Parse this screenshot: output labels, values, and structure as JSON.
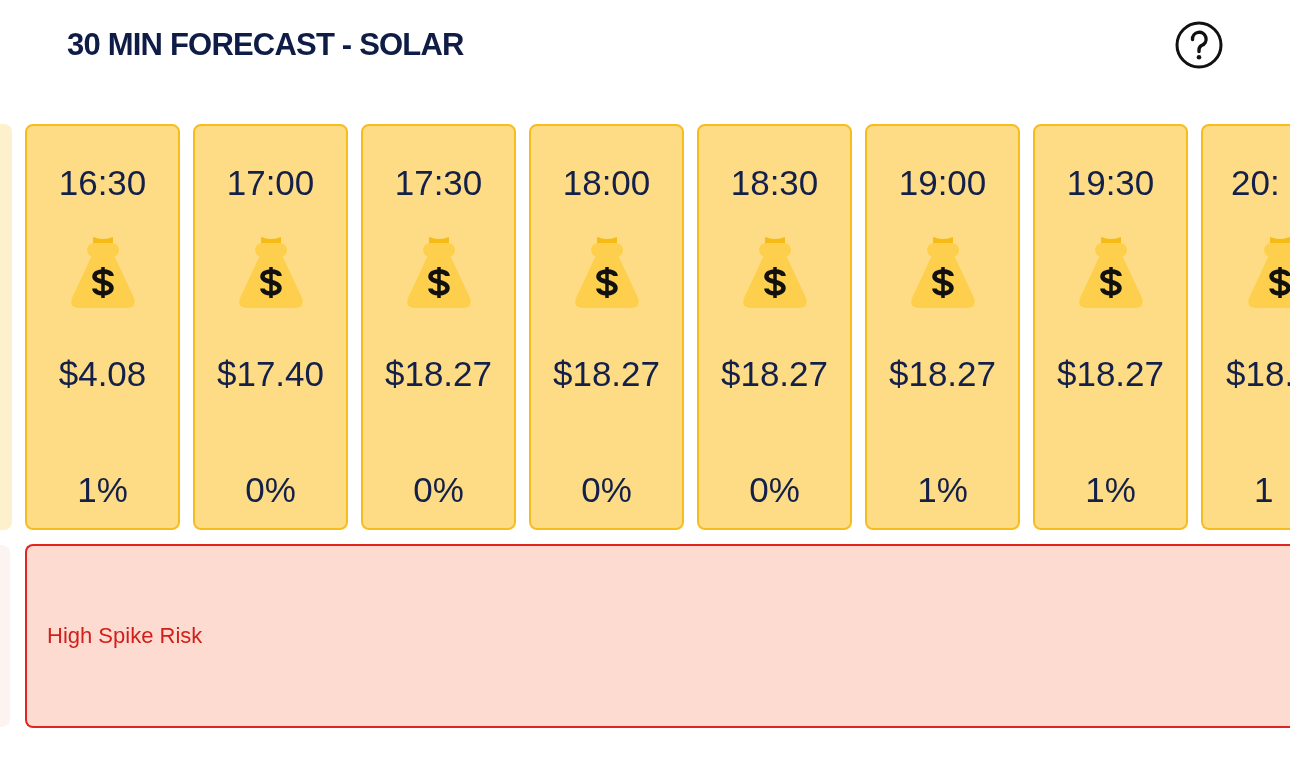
{
  "header": {
    "title": "30 MIN FORECAST - SOLAR"
  },
  "forecast": {
    "slots": [
      {
        "kind": "full",
        "time": "16:30",
        "price": "$4.08",
        "chance": "1%"
      },
      {
        "kind": "full",
        "time": "17:00",
        "price": "$17.40",
        "chance": "0%"
      },
      {
        "kind": "full",
        "time": "17:30",
        "price": "$18.27",
        "chance": "0%"
      },
      {
        "kind": "full",
        "time": "18:00",
        "price": "$18.27",
        "chance": "0%"
      },
      {
        "kind": "full",
        "time": "18:30",
        "price": "$18.27",
        "chance": "0%"
      },
      {
        "kind": "full",
        "time": "19:00",
        "price": "$18.27",
        "chance": "1%"
      },
      {
        "kind": "full",
        "time": "19:30",
        "price": "$18.27",
        "chance": "1%"
      },
      {
        "kind": "partial",
        "time": "20:",
        "price": "$18.",
        "chance": "1"
      }
    ]
  },
  "spike_risk": {
    "label": "High Spike Risk"
  }
}
